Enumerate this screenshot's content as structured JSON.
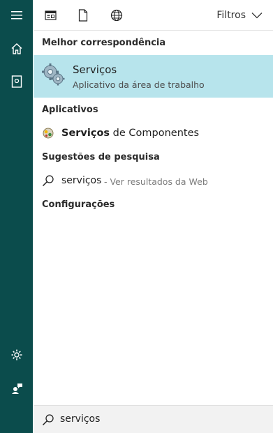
{
  "rail": {
    "icons": [
      "hamburger-menu-icon",
      "home-icon",
      "notebook-icon",
      "gear-icon",
      "feedback-icon"
    ]
  },
  "toolbar": {
    "icons": [
      "apps-filter-icon",
      "documents-filter-icon",
      "web-filter-icon"
    ],
    "filters_label": "Filtros"
  },
  "sections": {
    "best_match": "Melhor correspondência",
    "apps": "Aplicativos",
    "suggestions": "Sugestões de pesquisa",
    "settings": "Configurações"
  },
  "best_match": {
    "title": "Serviços",
    "subtitle": "Aplicativo da área de trabalho",
    "icon": "services-gears-icon"
  },
  "apps": [
    {
      "bold": "Serviços",
      "rest": " de Componentes",
      "icon": "component-services-icon"
    }
  ],
  "suggestions": [
    {
      "query": "serviços",
      "hint": " - Ver resultados da Web",
      "icon": "search-icon"
    }
  ],
  "search": {
    "value": "serviços",
    "icon": "search-icon"
  },
  "colors": {
    "rail": "#0b4c4c",
    "highlight": "#b7e4ec",
    "search_bg": "#f2f2f2"
  }
}
